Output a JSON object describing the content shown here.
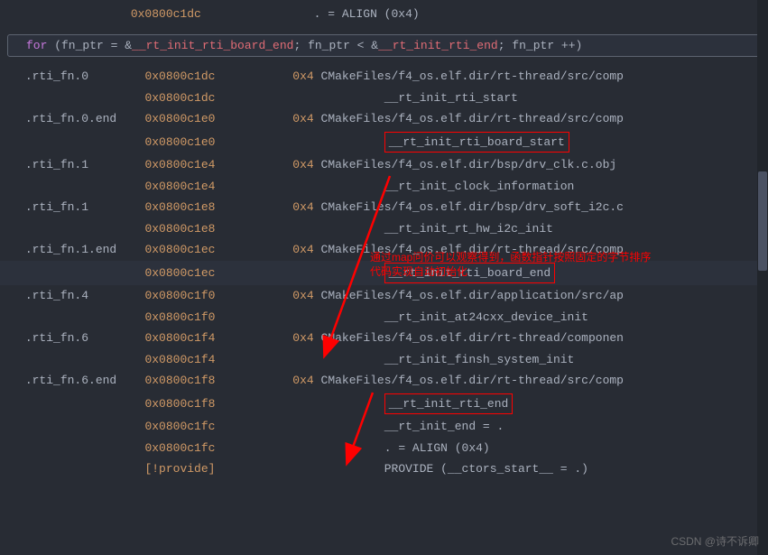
{
  "top_lines": [
    {
      "addr": "0x0800c1dc",
      "text": ". = ALIGN (0x4)"
    }
  ],
  "for_line": {
    "kw": "for",
    "open": " (fn_ptr = &",
    "sym1": "__rt_init_rti_board_end",
    "mid": "; fn_ptr < &",
    "sym2": "__rt_init_rti_end",
    "end": "; fn_ptr ++)"
  },
  "rows": [
    {
      "section": ".rti_fn.0",
      "addr": "0x0800c1dc",
      "size": "0x4",
      "path": "CMakeFiles/f4_os.elf.dir/rt-thread/src/comp"
    },
    {
      "section": "",
      "addr": "0x0800c1dc",
      "size": "",
      "sym": "__rt_init_rti_start"
    },
    {
      "section": ".rti_fn.0.end",
      "addr": "0x0800c1e0",
      "size": "0x4",
      "path": "CMakeFiles/f4_os.elf.dir/rt-thread/src/comp"
    },
    {
      "section": "",
      "addr": "0x0800c1e0",
      "size": "",
      "sym": "__rt_init_rti_board_start",
      "box": true
    },
    {
      "section": ".rti_fn.1",
      "addr": "0x0800c1e4",
      "size": "0x4",
      "path": "CMakeFiles/f4_os.elf.dir/bsp/drv_clk.c.obj"
    },
    {
      "section": "",
      "addr": "0x0800c1e4",
      "size": "",
      "sym": "__rt_init_clock_information"
    },
    {
      "section": ".rti_fn.1",
      "addr": "0x0800c1e8",
      "size": "0x4",
      "path": "CMakeFiles/f4_os.elf.dir/bsp/drv_soft_i2c.c"
    },
    {
      "section": "",
      "addr": "0x0800c1e8",
      "size": "",
      "sym": "__rt_init_rt_hw_i2c_init"
    },
    {
      "section": ".rti_fn.1.end",
      "addr": "0x0800c1ec",
      "size": "0x4",
      "path": "CMakeFiles/f4_os.elf.dir/rt-thread/src/comp"
    },
    {
      "section": "",
      "addr": "0x0800c1ec",
      "size": "",
      "sym": "__rt_init_rti_board_end",
      "box": true,
      "selected": true
    },
    {
      "section": ".rti_fn.4",
      "addr": "0x0800c1f0",
      "size": "0x4",
      "path": "CMakeFiles/f4_os.elf.dir/application/src/ap"
    },
    {
      "section": "",
      "addr": "0x0800c1f0",
      "size": "",
      "sym": "__rt_init_at24cxx_device_init"
    },
    {
      "section": ".rti_fn.6",
      "addr": "0x0800c1f4",
      "size": "0x4",
      "path": "CMakeFiles/f4_os.elf.dir/rt-thread/componen"
    },
    {
      "section": "",
      "addr": "0x0800c1f4",
      "size": "",
      "sym": "__rt_init_finsh_system_init"
    },
    {
      "section": ".rti_fn.6.end",
      "addr": "0x0800c1f8",
      "size": "0x4",
      "path": "CMakeFiles/f4_os.elf.dir/rt-thread/src/comp"
    },
    {
      "section": "",
      "addr": "0x0800c1f8",
      "size": "",
      "sym": "__rt_init_rti_end",
      "box": true
    },
    {
      "section": "",
      "addr": "0x0800c1fc",
      "size": "",
      "sym": "__rt_init_end = ."
    },
    {
      "section": "",
      "addr": "0x0800c1fc",
      "size": "",
      "sym": ". = ALIGN (0x4)"
    },
    {
      "section": "",
      "addr": "[!provide]",
      "size": "",
      "sym": "PROVIDE (__ctors_start__ = .)"
    }
  ],
  "annotation": {
    "line1": "通过map问价可以观察得到，函数指针按照固定的字节排序",
    "line2": "代码实现自动初始化"
  },
  "watermark": "CSDN @诗不诉卿"
}
